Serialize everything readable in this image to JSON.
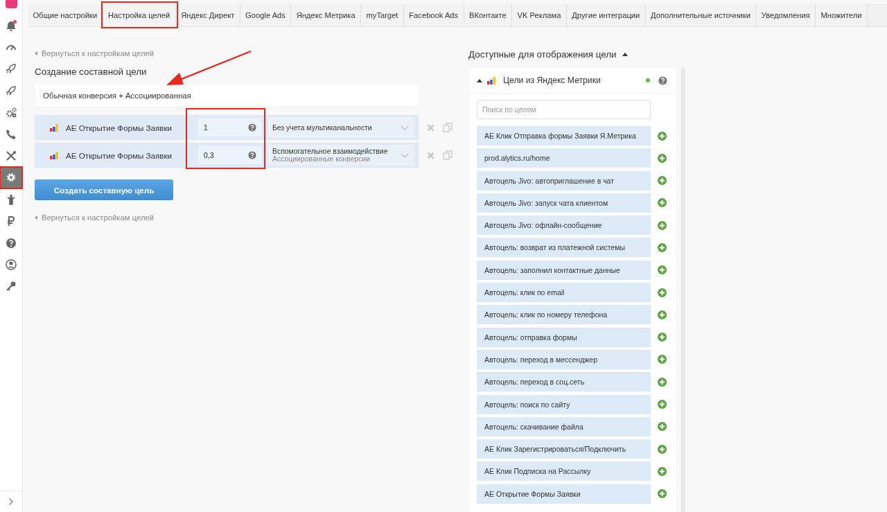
{
  "sidebar": {
    "items": [
      {
        "kind": "bell",
        "notification": true,
        "selected": false,
        "annotated": false
      },
      {
        "kind": "gauge",
        "notification": false,
        "selected": false,
        "annotated": false
      },
      {
        "kind": "rocket",
        "notification": false,
        "selected": false,
        "annotated": false
      },
      {
        "kind": "rocket",
        "notification": false,
        "selected": false,
        "annotated": false
      },
      {
        "kind": "gears",
        "notification": false,
        "selected": false,
        "annotated": false
      },
      {
        "kind": "phone",
        "notification": false,
        "selected": false,
        "annotated": false
      },
      {
        "kind": "tools",
        "notification": false,
        "selected": false,
        "annotated": false
      },
      {
        "kind": "gear",
        "notification": false,
        "selected": true,
        "annotated": true
      },
      {
        "kind": "person",
        "notification": false,
        "selected": false,
        "annotated": false
      },
      {
        "kind": "ruble",
        "notification": false,
        "selected": false,
        "annotated": false
      },
      {
        "kind": "question",
        "notification": false,
        "selected": false,
        "annotated": false
      },
      {
        "kind": "user",
        "notification": false,
        "selected": false,
        "annotated": false
      },
      {
        "kind": "key",
        "notification": false,
        "selected": false,
        "annotated": false
      }
    ]
  },
  "tabs": [
    {
      "label": "Общие настройки",
      "annotated": false
    },
    {
      "label": "Настройка целей",
      "annotated": true
    },
    {
      "label": "Яндекс Директ",
      "annotated": false
    },
    {
      "label": "Google Ads",
      "annotated": false
    },
    {
      "label": "Яндекс Метрика",
      "annotated": false
    },
    {
      "label": "myTarget",
      "annotated": false
    },
    {
      "label": "Facebook Ads",
      "annotated": false
    },
    {
      "label": "ВКонтакте",
      "annotated": false
    },
    {
      "label": "VK Реклама",
      "annotated": false
    },
    {
      "label": "Другие интеграции",
      "annotated": false
    },
    {
      "label": "Дополнительные источники",
      "annotated": false
    },
    {
      "label": "Уведомления",
      "annotated": false
    },
    {
      "label": "Множители",
      "annotated": false
    }
  ],
  "composite_goal": {
    "back_link": "Вернуться к настройкам целей",
    "title": "Создание составной цели",
    "type_value": "Обычная конверсия + Ассоциированная",
    "type_annotated": true,
    "weights_annotated": true,
    "rows": [
      {
        "name": "AE Открытие Формы Заявки",
        "weight": "1",
        "model": "Без учета мультиканальности"
      },
      {
        "name": "AE Открытие Формы Заявки",
        "weight": "0,3",
        "model": "Вспомогательное взаимодействие",
        "model_note": "Ассоциированные конверсии"
      }
    ],
    "create_button": "Создать составную цель",
    "back_link_bottom": "Вернуться к настройкам целей"
  },
  "goals_panel": {
    "title": "Доступные для отображения цели",
    "expanded": true,
    "source": {
      "title": "Цели из Яндекс Метрики",
      "expanded": true,
      "connected": true
    },
    "search_placeholder": "Поиск по целям",
    "items": [
      "AE Клик Отправка формы Заявки Я.Метрика",
      "prod.alytics.ru/home",
      "Автоцель Jivo: автоприглашение в чат",
      "Автоцель Jivo: запуск чата клиентом",
      "Автоцель Jivo: офлайн-сообщение",
      "Автоцель: возврат из платежной системы",
      "Автоцель: заполнил контактные данные",
      "Автоцель: клик по email",
      "Автоцель: клик по номеру телефона",
      "Автоцель: отправка формы",
      "Автоцель: переход в мессенджер",
      "Автоцель: переход в соц.сеть",
      "Автоцель: поиск по сайту",
      "Автоцель: скачивание файла",
      "AE Клик Зарегистрироваться/Подключить",
      "AE Клик Подписка на Рассылку",
      "AE Открытие Формы Заявки"
    ]
  }
}
